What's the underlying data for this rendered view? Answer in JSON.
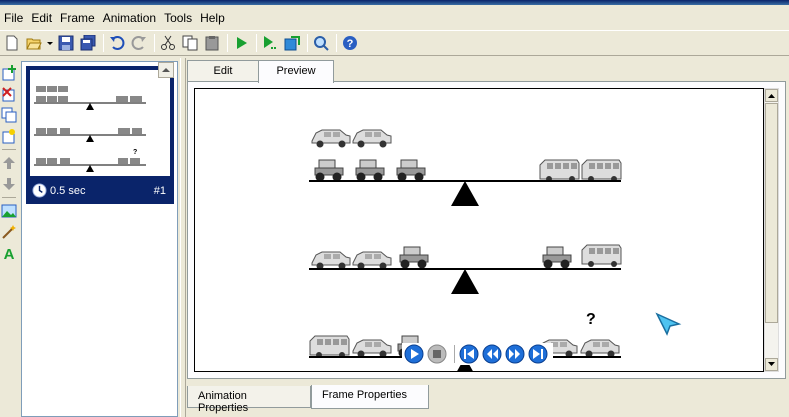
{
  "menu": [
    "File",
    "Edit",
    "Frame",
    "Animation",
    "Tools",
    "Help"
  ],
  "toolbar": {
    "icons": [
      "new-icon",
      "open-icon",
      "dropdown-icon",
      "save-icon",
      "save-all-icon",
      "undo-icon",
      "redo-icon",
      "cut-icon",
      "copy-icon",
      "paste-icon",
      "play-icon",
      "play-from-frame-icon",
      "export-icon",
      "zoom-icon",
      "help-icon"
    ]
  },
  "left_tools": {
    "icons": [
      "add-frame-icon",
      "delete-frame-icon",
      "duplicate-frame-icon",
      "insert-frame-icon",
      "move-up-icon",
      "move-down-icon",
      "image-icon",
      "wand-icon",
      "text-icon"
    ]
  },
  "frames": [
    {
      "time": "0.5 sec",
      "number": "#1"
    }
  ],
  "tabs": {
    "edit": "Edit",
    "preview": "Preview"
  },
  "bottom_tabs": {
    "animation": "Animation Properties",
    "frame": "Frame Properties"
  },
  "preview": {
    "question_mark": "?",
    "rows": [
      {
        "left_top": [
          "car",
          "car"
        ],
        "left_bottom": [
          "tractor",
          "tractor",
          "tractor"
        ],
        "right": [
          "bus",
          "bus"
        ]
      },
      {
        "left_top": [],
        "left_bottom": [
          "car",
          "car",
          "tractor"
        ],
        "right": [
          "tractor",
          "bus"
        ]
      },
      {
        "left_top": [],
        "left_bottom": [
          "bus",
          "car",
          "tractor"
        ],
        "right": [
          "car",
          "car"
        ]
      }
    ]
  },
  "player": {
    "icons": [
      "play-button-icon",
      "stop-button-icon",
      "first-frame-icon",
      "previous-frame-icon",
      "next-frame-icon",
      "last-frame-icon"
    ]
  },
  "colors": {
    "accent": "#0a246a",
    "player_blue": "#1e6fd8",
    "selection": "#0a246a"
  }
}
